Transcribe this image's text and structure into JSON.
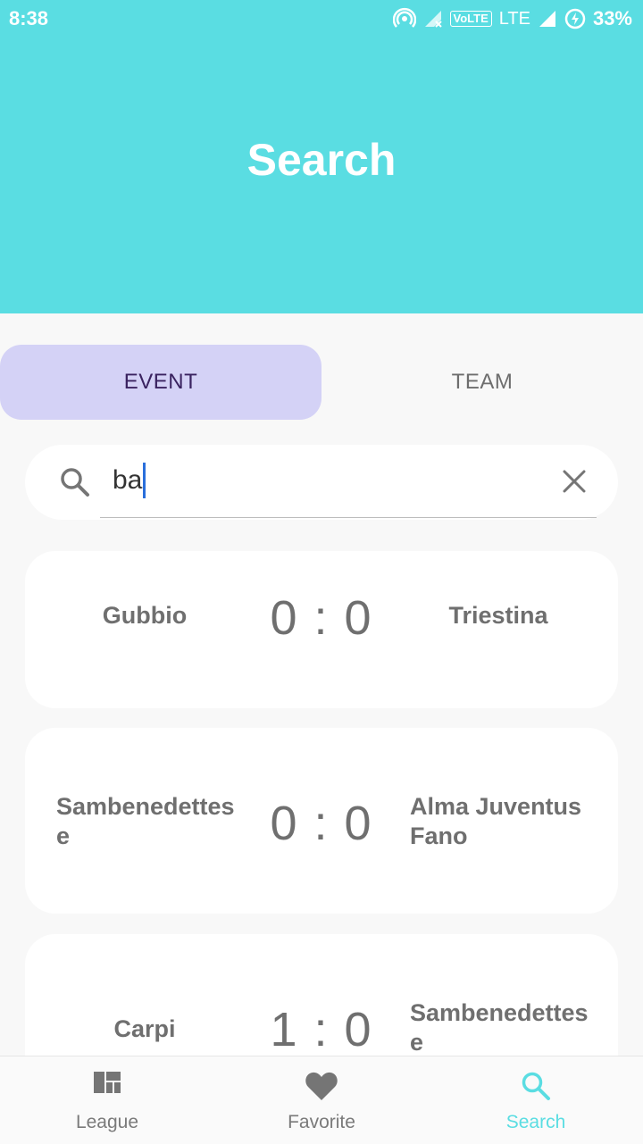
{
  "status_bar": {
    "time": "8:38",
    "volte_label": "VoLTE",
    "network_label": "LTE",
    "battery_percent": "33%"
  },
  "header": {
    "title": "Search"
  },
  "tabs": [
    {
      "label": "EVENT",
      "selected": true
    },
    {
      "label": "TEAM",
      "selected": false
    }
  ],
  "search": {
    "value": "ba"
  },
  "events": [
    {
      "home": "Gubbio",
      "score": "0 : 0",
      "away": "Triestina"
    },
    {
      "home": "Sambenedettes e",
      "score": "0 : 0",
      "away": "Alma Juventus Fano"
    },
    {
      "home": "Carpi",
      "score": "1 : 0",
      "away": "Sambenedettes e"
    }
  ],
  "bottom_nav": [
    {
      "label": "League",
      "icon": "league-icon",
      "active": false
    },
    {
      "label": "Favorite",
      "icon": "heart-icon",
      "active": false
    },
    {
      "label": "Search",
      "icon": "search-icon",
      "active": true
    }
  ],
  "colors": {
    "header": "#5adde2",
    "tab_selected_bg": "#d4d2f6",
    "accent": "#5adde2",
    "text_gray": "#6f6f6f"
  }
}
